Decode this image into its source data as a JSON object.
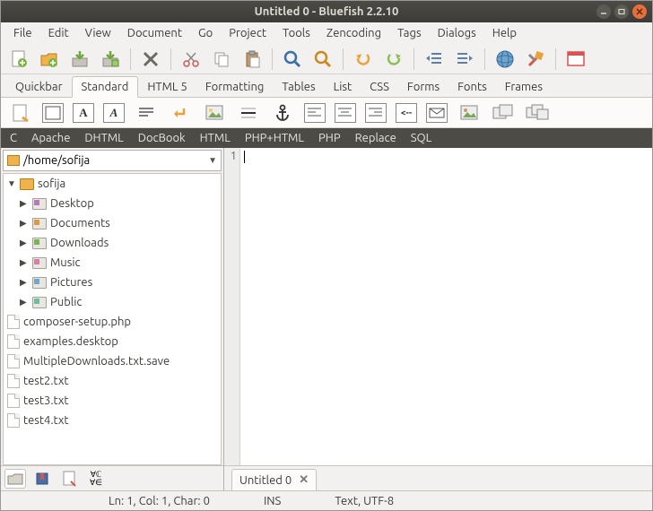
{
  "window": {
    "title": "Untitled 0 - Bluefish 2.2.10"
  },
  "menu": [
    "File",
    "Edit",
    "View",
    "Document",
    "Go",
    "Project",
    "Tools",
    "Zencoding",
    "Tags",
    "Dialogs",
    "Help"
  ],
  "tabs": {
    "items": [
      "Quickbar",
      "Standard",
      "HTML 5",
      "Formatting",
      "Tables",
      "List",
      "CSS",
      "Forms",
      "Fonts",
      "Frames"
    ],
    "active": 1
  },
  "langbar": [
    "C",
    "Apache",
    "DHTML",
    "DocBook",
    "HTML",
    "PHP+HTML",
    "PHP",
    "Replace",
    "SQL"
  ],
  "sidebar": {
    "path": "/home/sofija",
    "root": {
      "name": "sofija",
      "expanded": true
    },
    "folders": [
      "Desktop",
      "Documents",
      "Downloads",
      "Music",
      "Pictures",
      "Public"
    ],
    "files": [
      "composer-setup.php",
      "examples.desktop",
      "MultipleDownloads.txt.save",
      "test2.txt",
      "test3.txt",
      "test4.txt"
    ]
  },
  "editor": {
    "line_numbers": [
      "1"
    ],
    "doc_tab": "Untitled 0"
  },
  "status": {
    "position": "Ln: 1, Col: 1, Char: 0",
    "mode": "INS",
    "encoding": "Text, UTF-8"
  }
}
